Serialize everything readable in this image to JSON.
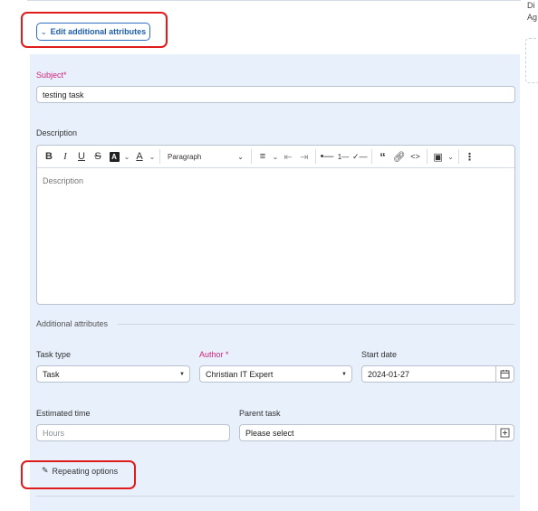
{
  "right_fragment": {
    "line1": "Di",
    "line2": "Ag"
  },
  "edit_button": {
    "label": "Edit additional attributes"
  },
  "subject": {
    "label": "Subject*",
    "value": "testing task"
  },
  "description": {
    "label": "Description",
    "paragraph_select": "Paragraph",
    "placeholder": "Description"
  },
  "additional": {
    "heading": "Additional attributes",
    "task_type": {
      "label": "Task type",
      "value": "Task"
    },
    "author": {
      "label": "Author *",
      "value": "Christian IT Expert"
    },
    "start_date": {
      "label": "Start date",
      "value": "2024-01-27"
    },
    "estimated_time": {
      "label": "Estimated time",
      "placeholder": "Hours"
    },
    "parent_task": {
      "label": "Parent task",
      "value": "Please select"
    }
  },
  "repeating": {
    "label": "Repeating options"
  },
  "colors": {
    "accent": "#1f5fae",
    "required": "#d4237a",
    "highlight": "#e01b1b",
    "panel": "#e8f0fb"
  }
}
